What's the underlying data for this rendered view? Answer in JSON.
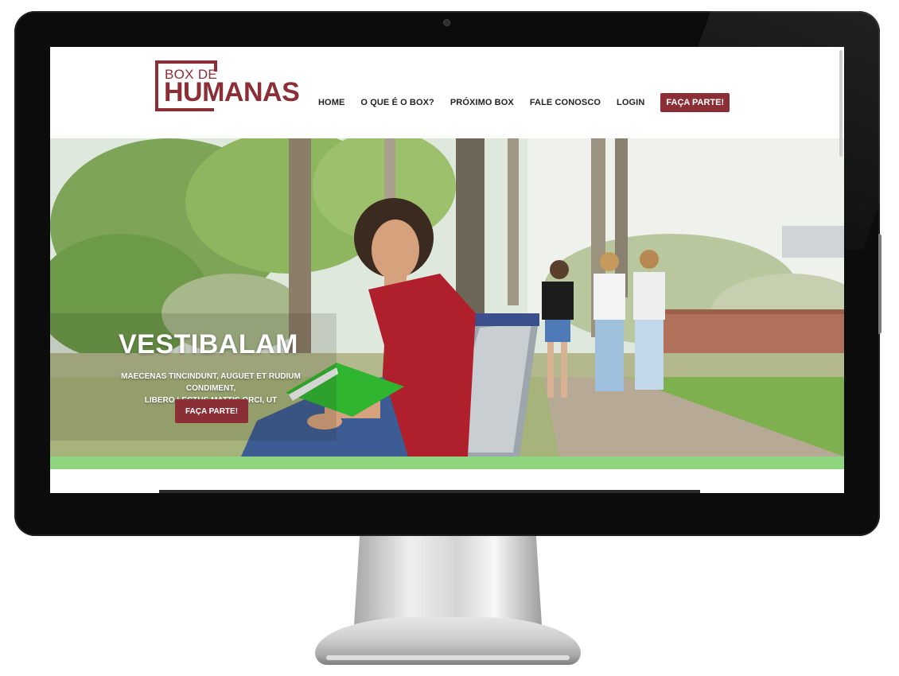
{
  "logo": {
    "small_text": "BOX DE",
    "big_text": "HUMANAS",
    "brand_color": "#8b2e35"
  },
  "nav": {
    "items": [
      {
        "label": "HOME"
      },
      {
        "label": "O QUE É O BOX?"
      },
      {
        "label": "PRÓXIMO BOX"
      },
      {
        "label": "FALE CONOSCO"
      },
      {
        "label": "LOGIN"
      }
    ],
    "cta_label": "FAÇA PARTE!"
  },
  "hero": {
    "title": "VESTIBALAM",
    "subtitle_line1": "MAECENAS TINCINDUNT, AUGUET ET RUDIUM CONDIMENT,",
    "subtitle_line2": "LIBERO LECTUS MATTIS ORCI, UT",
    "cta_label": "FAÇA PARTE!",
    "accent_strip_color": "#8fd47e"
  }
}
